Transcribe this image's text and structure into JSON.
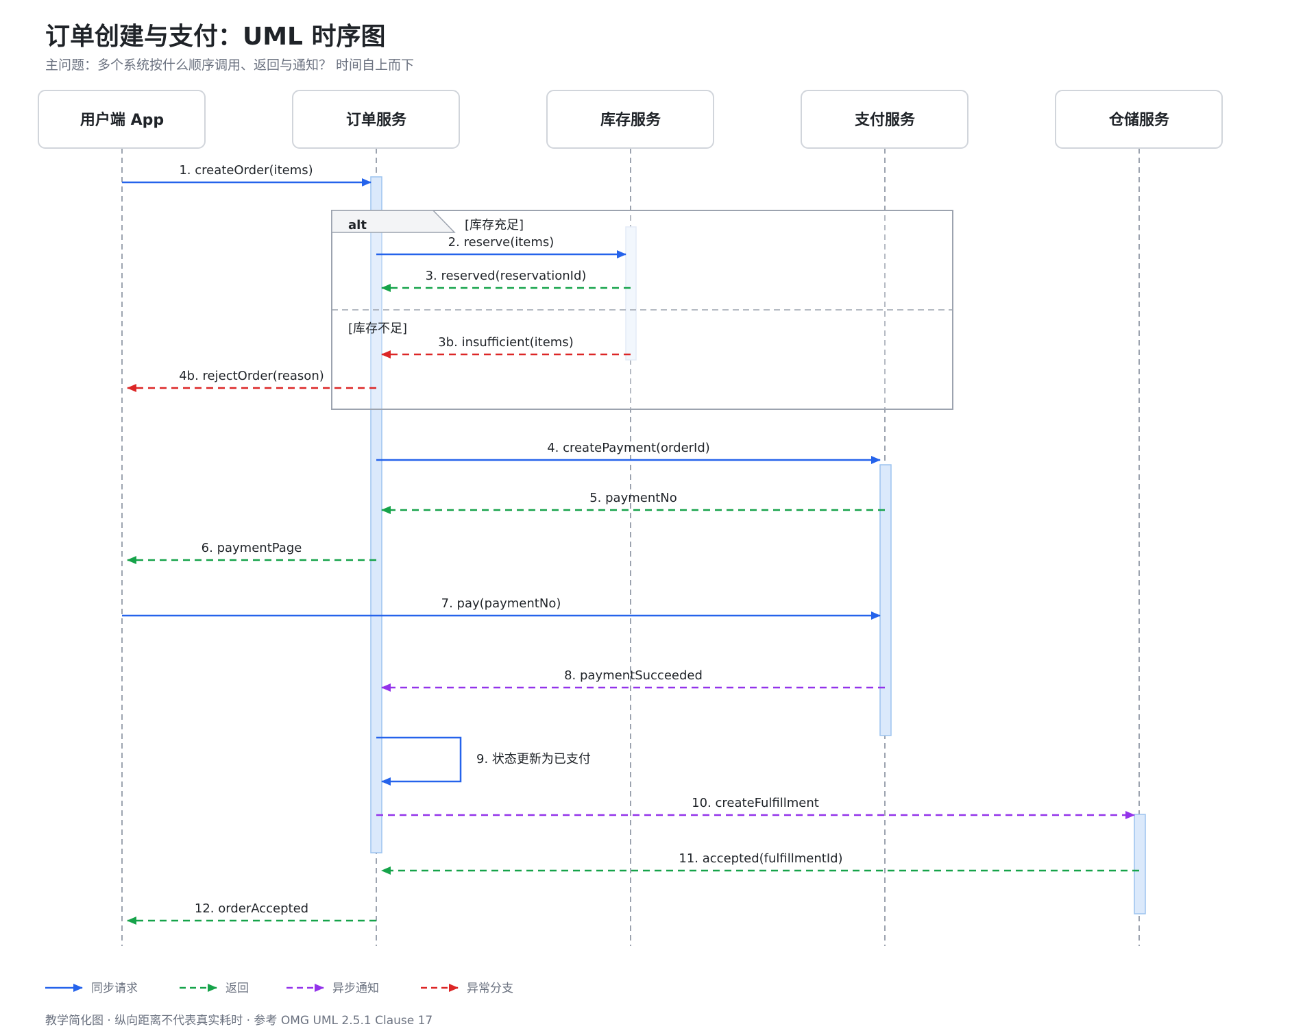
{
  "title": "订单创建与支付：UML 时序图",
  "subtitle": "主问题：多个系统按什么顺序调用、返回与通知？ 时间自上而下",
  "participants": [
    "用户端 App",
    "订单服务",
    "库存服务",
    "支付服务",
    "仓储服务"
  ],
  "fragment": {
    "operator": "alt",
    "guard1": "[库存充足]",
    "guard2": "[库存不足]"
  },
  "messages": [
    {
      "label": "1. createOrder(items)",
      "from": 0,
      "to": 1,
      "kind": "sync"
    },
    {
      "label": "2. reserve(items)",
      "from": 1,
      "to": 2,
      "kind": "sync"
    },
    {
      "label": "3. reserved(reservationId)",
      "from": 2,
      "to": 1,
      "kind": "return"
    },
    {
      "label": "3b. insufficient(items)",
      "from": 2,
      "to": 1,
      "kind": "exception"
    },
    {
      "label": "4b. rejectOrder(reason)",
      "from": 1,
      "to": 0,
      "kind": "exception"
    },
    {
      "label": "4. createPayment(orderId)",
      "from": 1,
      "to": 3,
      "kind": "sync"
    },
    {
      "label": "5. paymentNo",
      "from": 3,
      "to": 1,
      "kind": "return"
    },
    {
      "label": "6. paymentPage",
      "from": 1,
      "to": 0,
      "kind": "return"
    },
    {
      "label": "7. pay(paymentNo)",
      "from": 0,
      "to": 3,
      "kind": "sync"
    },
    {
      "label": "8. paymentSucceeded",
      "from": 3,
      "to": 1,
      "kind": "async"
    },
    {
      "label": "9. 状态更新为已支付",
      "from": 1,
      "to": 1,
      "kind": "sync"
    },
    {
      "label": "10. createFulfillment",
      "from": 1,
      "to": 4,
      "kind": "async"
    },
    {
      "label": "11. accepted(fulfillmentId)",
      "from": 4,
      "to": 1,
      "kind": "return"
    },
    {
      "label": "12. orderAccepted",
      "from": 1,
      "to": 0,
      "kind": "return"
    }
  ],
  "legend": [
    {
      "label": "同步请求",
      "kind": "sync"
    },
    {
      "label": "返回",
      "kind": "return"
    },
    {
      "label": "异步通知",
      "kind": "async"
    },
    {
      "label": "异常分支",
      "kind": "exception"
    }
  ],
  "colors": {
    "sync": "#2563eb",
    "return": "#16a34a",
    "async": "#9333ea",
    "exception": "#dc2626",
    "lifeline": "#9ca3af",
    "activation_fill": "#dbe9fb",
    "activation_stroke": "#9cc3ef"
  },
  "footnote": "教学简化图 · 纵向距离不代表真实耗时 · 参考 OMG UML 2.5.1 Clause 17"
}
